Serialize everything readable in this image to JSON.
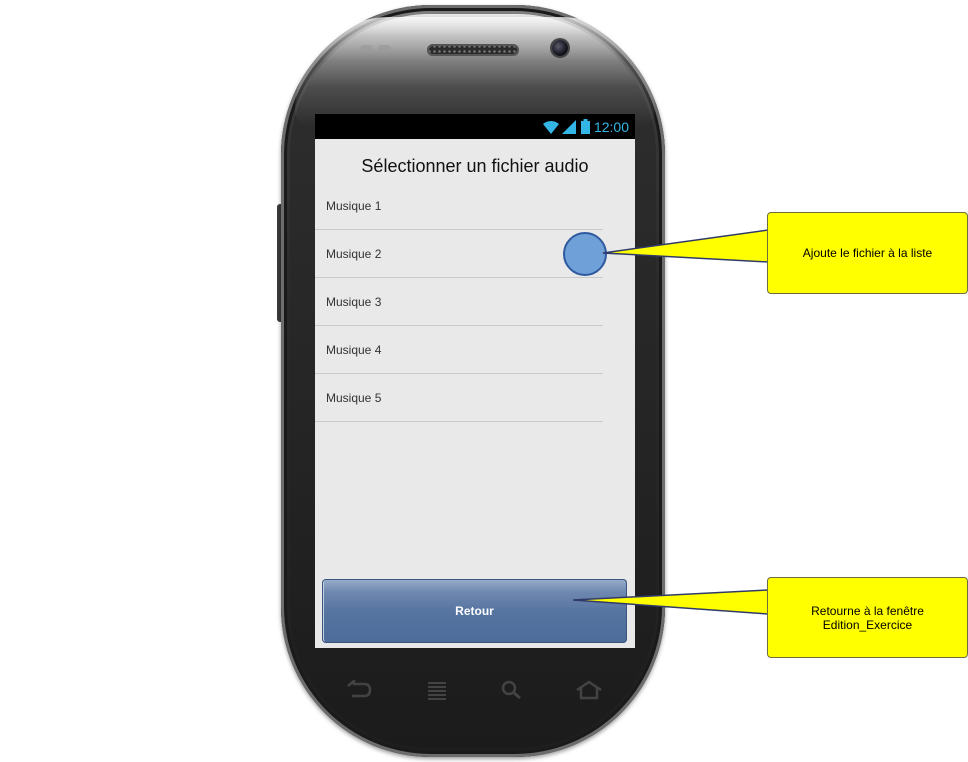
{
  "status_bar": {
    "time": "12:00"
  },
  "screen": {
    "title": "Sélectionner un fichier audio",
    "items": [
      {
        "label": "Musique 1"
      },
      {
        "label": "Musique 2"
      },
      {
        "label": "Musique 3"
      },
      {
        "label": "Musique 4"
      },
      {
        "label": "Musique 5"
      }
    ],
    "back_button": "Retour"
  },
  "annotations": {
    "add_file": "Ajoute le fichier à la liste",
    "back_line1": "Retourne à la fenêtre",
    "back_line2": "Edition_Exercice"
  },
  "colors": {
    "callout": "#ffff00",
    "button": "#5775a1",
    "marker": "#6fa0d8",
    "status_text": "#33b5e5"
  },
  "icons": [
    "wifi-icon",
    "signal-icon",
    "battery-icon",
    "back-icon",
    "menu-icon",
    "search-icon",
    "home-icon"
  ]
}
